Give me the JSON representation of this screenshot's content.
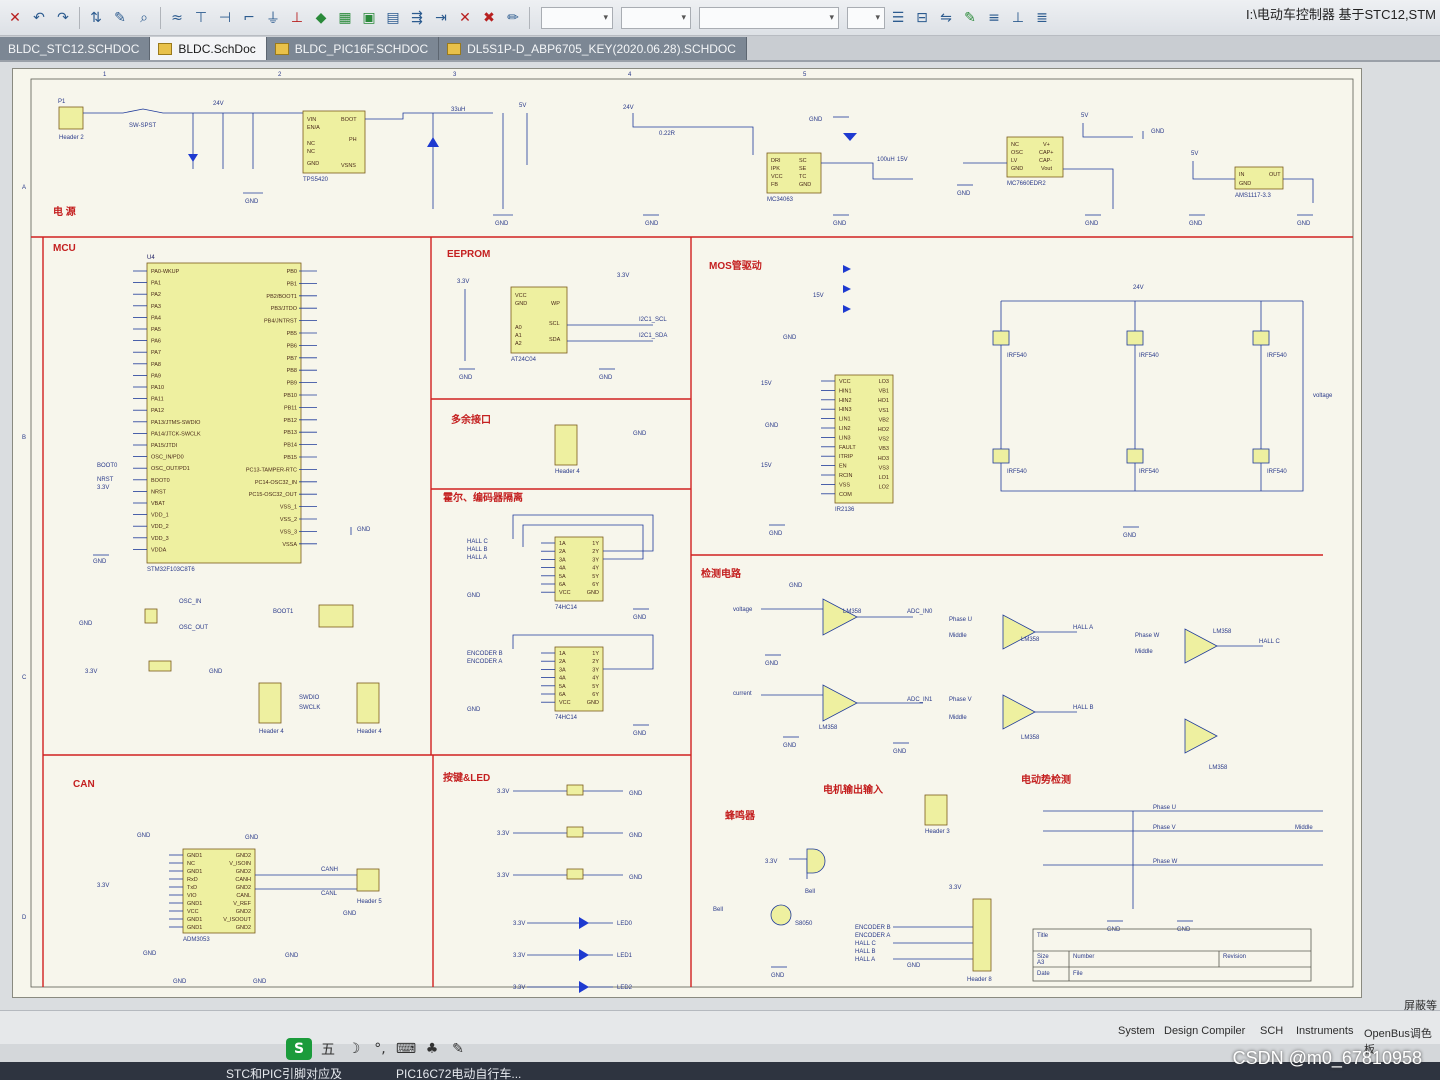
{
  "window": {
    "title": "I:\\电动车控制器 基于STC12,STM"
  },
  "toolbar": {
    "buttons": [
      {
        "name": "undo-icon",
        "glyph": "↶"
      },
      {
        "name": "redo-icon",
        "glyph": "↷"
      },
      {
        "name": "cross-probe-icon",
        "glyph": "⇅"
      },
      {
        "name": "pencil-icon",
        "glyph": "✎"
      },
      {
        "name": "zoom-icon",
        "glyph": "⌕"
      },
      {
        "name": "wire-icon",
        "glyph": "≈"
      },
      {
        "name": "bus-icon",
        "glyph": "⊤"
      },
      {
        "name": "bus-entry-icon",
        "glyph": "⊣"
      },
      {
        "name": "net-label-icon",
        "glyph": "⌐"
      },
      {
        "name": "gnd-port-icon",
        "glyph": "⏚"
      },
      {
        "name": "vcc-port-icon",
        "glyph": "⊥"
      },
      {
        "name": "part-icon",
        "glyph": "◆"
      },
      {
        "name": "sheet-symbol-icon",
        "glyph": "▦"
      },
      {
        "name": "sheet-entry-icon",
        "glyph": "▣"
      },
      {
        "name": "device-sheet-icon",
        "glyph": "▤"
      },
      {
        "name": "port-icon",
        "glyph": "⇶"
      },
      {
        "name": "harness-icon",
        "glyph": "⇥"
      },
      {
        "name": "no-erc-icon",
        "glyph": "✕"
      },
      {
        "name": "parameter-set-icon",
        "glyph": "✖"
      },
      {
        "name": "line-icon",
        "glyph": "✏"
      }
    ],
    "right_buttons": [
      {
        "name": "align-icon",
        "glyph": "☰"
      },
      {
        "name": "distribute-icon",
        "glyph": "⊟"
      },
      {
        "name": "order-icon",
        "glyph": "⇋"
      },
      {
        "name": "highlighter-icon",
        "glyph": "✎"
      },
      {
        "name": "arrange-icon",
        "glyph": "≡"
      },
      {
        "name": "grid-icon",
        "glyph": "⊥"
      },
      {
        "name": "snap-icon",
        "glyph": "≣"
      }
    ],
    "combo_labels": [
      "",
      "...",
      "...",
      ""
    ]
  },
  "tabs": [
    {
      "label": "BLDC_STC12.SCHDOC",
      "active": false
    },
    {
      "label": "BLDC.SchDoc",
      "active": true
    },
    {
      "label": "BLDC_PIC16F.SCHDOC",
      "active": false
    },
    {
      "label": "DL5S1P-D_ABP6705_KEY(2020.06.28).SCHDOC",
      "active": false
    }
  ],
  "sheet": {
    "border_columns": [
      "1",
      "2",
      "3",
      "4",
      "5"
    ],
    "border_rows": [
      "A",
      "B",
      "C",
      "D"
    ],
    "sections": {
      "power": "电 源",
      "mcu": "MCU",
      "eeprom": "EEPROM",
      "mos_drive": "MOS管驱动",
      "multi_if": "多余接口",
      "hall_enc": "霍尔、编码器隔离",
      "detect": "检测电路",
      "can": "CAN",
      "keys_led": "按键&LED",
      "motor_out": "电机输出输入",
      "buzzer": "蜂鸣器",
      "ebrake": "电动势检测"
    },
    "chips": {
      "tps": {
        "label": "TPS5420",
        "pins": [
          "VIN",
          "EN/A",
          "NC",
          "NC",
          "GND",
          "BOOT",
          "PH",
          "VSNS"
        ]
      },
      "mc34063": {
        "label": "MC34063",
        "pins": [
          "DRI",
          "IPK",
          "VCC",
          "FB",
          "SC",
          "SE",
          "TC",
          "GND"
        ]
      },
      "mc7660": {
        "label": "MC7660EDR2",
        "pins": [
          "NC",
          "OSC",
          "LV",
          "GND",
          "V+",
          "CAP+",
          "CAP-",
          "Vout"
        ]
      },
      "ams": {
        "label": "AMS1117-3.3",
        "pins": [
          "IN",
          "GND",
          "OUT"
        ]
      },
      "stm32": {
        "label": "STM32F103C8T6",
        "ref": "U4",
        "left_pins": [
          "PA0-WKUP",
          "PA1",
          "PA2",
          "PA3",
          "PA4",
          "PA5",
          "PA6",
          "PA7",
          "PA8",
          "PA9",
          "PA10",
          "PA11",
          "PA12",
          "PA13/JTMS-SWDIO",
          "PA14/JTCK-SWCLK",
          "PA15/JTDI",
          "OSC_IN/PD0",
          "OSC_OUT/PD1",
          "BOOT0",
          "NRST",
          "VBAT",
          "VDD_1",
          "VDD_2",
          "VDD_3",
          "VDDA"
        ],
        "right_pins": [
          "PB0",
          "PB1",
          "PB2/BOOT1",
          "PB3/JTDO",
          "PB4/JNTRST",
          "PB5",
          "PB6",
          "PB7",
          "PB8",
          "PB9",
          "PB10",
          "PB11",
          "PB12",
          "PB13",
          "PB14",
          "PB15",
          "PC13-TAMPER-RTC",
          "PC14-OSC32_IN",
          "PC15-OSC32_OUT",
          "VSS_1",
          "VSS_2",
          "VSS_3",
          "VSSA"
        ]
      },
      "at24": {
        "label": "AT24C04",
        "pins": [
          "VCC",
          "GND",
          "A0",
          "A1",
          "A2",
          "WP",
          "SCL",
          "SDA"
        ]
      },
      "ir2136": {
        "label": "IR2136",
        "pins": [
          "VCC",
          "HIN1",
          "HIN2",
          "HIN3",
          "LIN1",
          "LIN2",
          "LIN3",
          "FAULT",
          "ITRIP",
          "EN",
          "RCIN",
          "VSS",
          "COM",
          "LO3",
          "VB1",
          "HO1",
          "VS1",
          "VB2",
          "HO2",
          "VS2",
          "VB3",
          "HO3",
          "VS3",
          "LO1",
          "LO2"
        ]
      },
      "u8": {
        "label": "74HC14",
        "pins": [
          "1A",
          "2A",
          "3A",
          "4A",
          "5A",
          "6A",
          "VCC",
          "1Y",
          "2Y",
          "3Y",
          "4Y",
          "5Y",
          "6Y",
          "GND"
        ]
      },
      "u10": {
        "label": "74HC14",
        "pins": [
          "1A",
          "2A",
          "3A",
          "4A",
          "5A",
          "6A",
          "VCC",
          "1Y",
          "2Y",
          "3Y",
          "4Y",
          "5Y",
          "6Y",
          "GND"
        ]
      },
      "can": {
        "label": "ADM3053",
        "pins": [
          "GND1",
          "NC",
          "GND1",
          "RxD",
          "TxD",
          "VIO",
          "GND1",
          "VCC",
          "GND1",
          "GND1",
          "GND2",
          "V_ISOIN",
          "GND2",
          "CANH",
          "GND2",
          "CANL",
          "V_REF",
          "GND2",
          "V_ISOOUT",
          "GND2"
        ]
      }
    },
    "net_labels": {
      "p1": "P1",
      "header2": "Header 2",
      "sw": "SW-SPST",
      "gnd": "GND",
      "v24": "24V",
      "v5": "5V",
      "v15": "15V",
      "v33": "3.3V",
      "rsh": "0.22R",
      "ind": "33uH",
      "ind2": "100uH",
      "i2c_scl": "I2C1_SCL",
      "i2c_sda": "I2C1_SDA",
      "hall_a": "HALL A",
      "hall_b": "HALL B",
      "hall_c": "HALL C",
      "enc_a": "ENCODER A",
      "enc_b": "ENCODER B",
      "adc_in0": "ADC_IN0",
      "adc_in1": "ADC_IN1",
      "phase_u": "Phase U",
      "phase_v": "Phase V",
      "phase_w": "Phase W",
      "middle": "Middle",
      "lm358": "LM358",
      "irf540": "IRF540",
      "voltage": "voltage",
      "current": "current",
      "osc_in": "OSC_IN",
      "osc_out": "OSC_OUT",
      "boot1": "BOOT1",
      "swdio": "SWDIO",
      "swclk": "SWCLK",
      "boot0": "BOOT0",
      "nrst": "NRST",
      "can_h": "CANH",
      "can_l": "CANL",
      "led0": "LED0",
      "led1": "LED1",
      "led2": "LED2",
      "bell": "Bell",
      "q7": "S8050",
      "bell_ref": "Bell",
      "header4": "Header 4",
      "header3": "Header 3",
      "header5": "Header 5",
      "header8": "Header 8",
      "title": "Title",
      "size": "Size",
      "number": "Number",
      "revision": "Revision",
      "a3": "A3",
      "date": "Date",
      "file": "File"
    }
  },
  "status": {
    "items": [
      "System",
      "Design Compiler",
      "SCH",
      "Instruments",
      "OpenBus调色板"
    ],
    "mask": "屏蔽等"
  },
  "ime": {
    "logo": "S",
    "items": [
      "五",
      "☽",
      "°,",
      "⌨",
      "♣",
      "✎"
    ]
  },
  "taskbar": {
    "items": [
      "STC和PIC引脚对应及",
      "PIC16C72电动自行车..."
    ]
  },
  "watermark": "CSDN @m0_67810958"
}
